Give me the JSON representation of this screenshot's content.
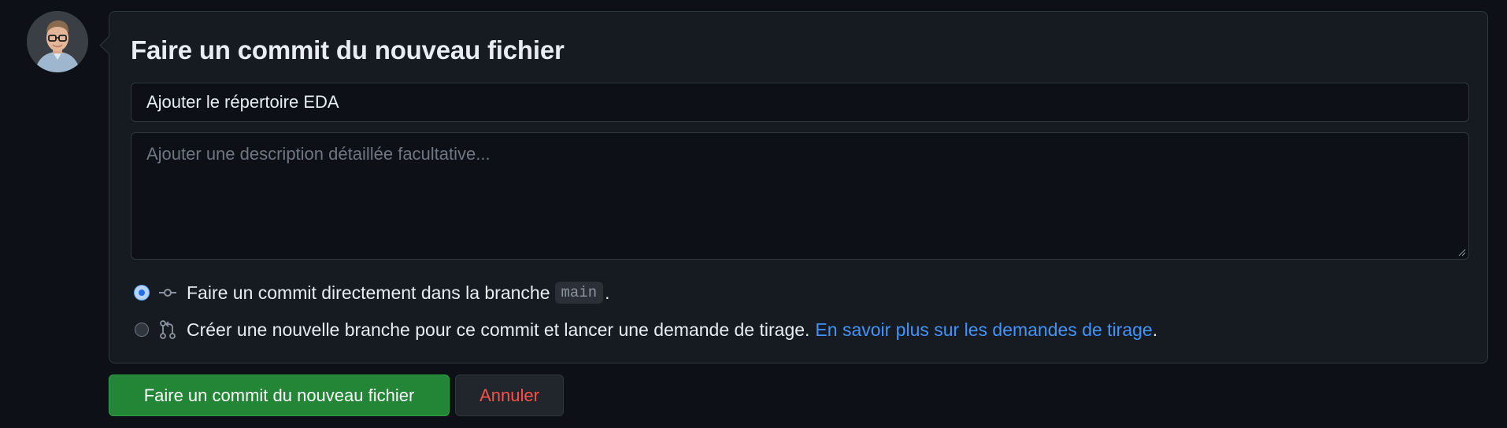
{
  "avatar": {
    "alt": "User avatar"
  },
  "commit_form": {
    "title": "Faire un commit du nouveau fichier",
    "summary_value": "Ajouter le répertoire EDA",
    "description_placeholder": "Ajouter une description détaillée facultative...",
    "options": [
      {
        "label": "Faire un commit directement dans la branche",
        "branch": "main",
        "suffix": ".",
        "icon": "git-commit-icon",
        "checked": true
      },
      {
        "label": "Créer une nouvelle branche pour ce commit et lancer une demande de tirage.",
        "link_text": "En savoir plus sur les demandes de tirage",
        "suffix": ".",
        "icon": "git-pull-request-icon",
        "checked": false
      }
    ]
  },
  "actions": {
    "commit_label": "Faire un commit du nouveau fichier",
    "cancel_label": "Annuler"
  },
  "colors": {
    "background": "#0d1117",
    "panel": "#161b22",
    "border": "#30363d",
    "primary_button": "#238636",
    "danger_text": "#f85149",
    "link": "#4493f8",
    "radio_accent": "#1f6feb"
  }
}
